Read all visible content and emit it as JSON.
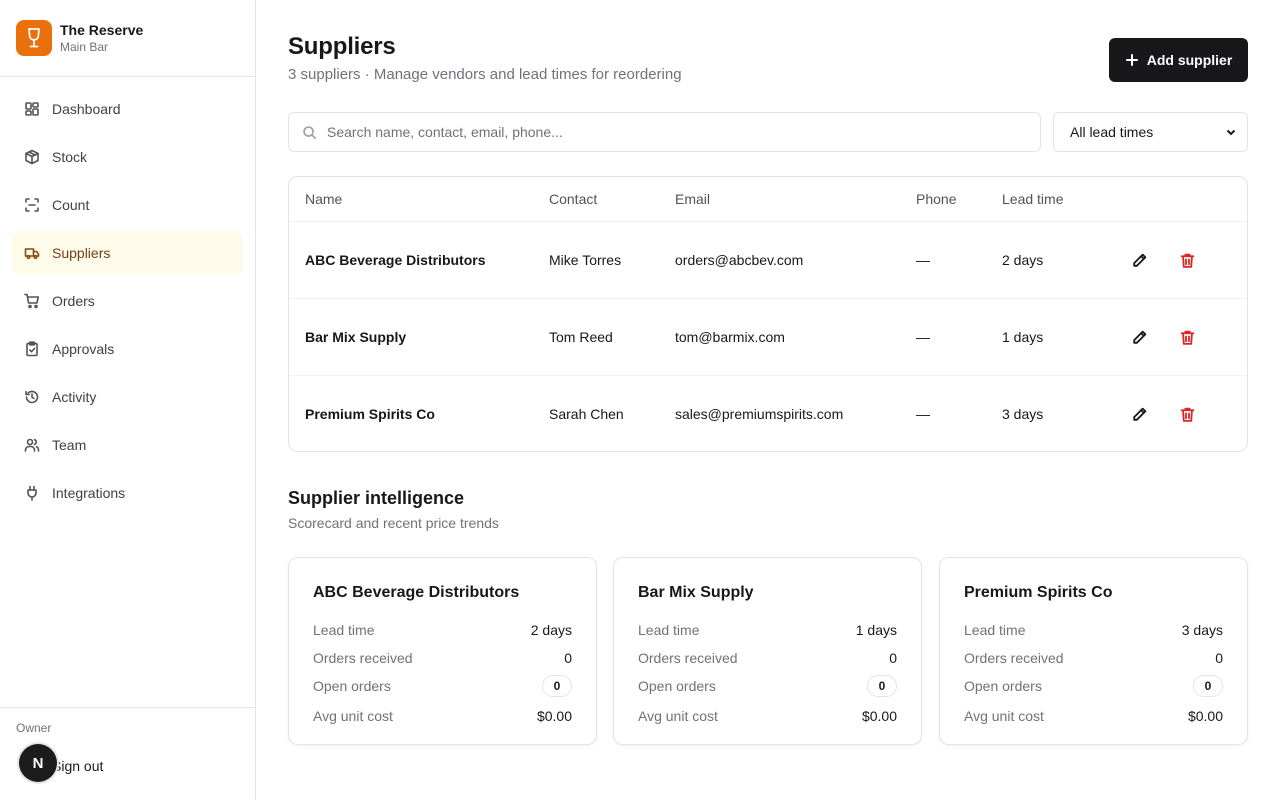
{
  "brand": {
    "name": "The Reserve",
    "subtitle": "Main Bar"
  },
  "nav": [
    {
      "label": "Dashboard",
      "icon": "dashboard-icon",
      "active": false
    },
    {
      "label": "Stock",
      "icon": "box-icon",
      "active": false
    },
    {
      "label": "Count",
      "icon": "scan-icon",
      "active": false
    },
    {
      "label": "Suppliers",
      "icon": "truck-icon",
      "active": true
    },
    {
      "label": "Orders",
      "icon": "cart-icon",
      "active": false
    },
    {
      "label": "Approvals",
      "icon": "clipboard-check-icon",
      "active": false
    },
    {
      "label": "Activity",
      "icon": "history-icon",
      "active": false
    },
    {
      "label": "Team",
      "icon": "users-icon",
      "active": false
    },
    {
      "label": "Integrations",
      "icon": "plug-icon",
      "active": false
    }
  ],
  "footer": {
    "role": "Owner",
    "sign_out": "Sign out",
    "avatar_initial": "N"
  },
  "header": {
    "title": "Suppliers",
    "subtitle": "3 suppliers · Manage vendors and lead times for reordering",
    "add_button": "Add supplier"
  },
  "filters": {
    "search_placeholder": "Search name, contact, email, phone...",
    "lead_time_select": "All lead times"
  },
  "table": {
    "columns": [
      "Name",
      "Contact",
      "Email",
      "Phone",
      "Lead time"
    ],
    "rows": [
      {
        "name": "ABC Beverage Distributors",
        "contact": "Mike Torres",
        "email": "orders@abcbev.com",
        "phone": "—",
        "lead_time": "2 days"
      },
      {
        "name": "Bar Mix Supply",
        "contact": "Tom Reed",
        "email": "tom@barmix.com",
        "phone": "—",
        "lead_time": "1 days"
      },
      {
        "name": "Premium Spirits Co",
        "contact": "Sarah Chen",
        "email": "sales@premiumspirits.com",
        "phone": "—",
        "lead_time": "3 days"
      }
    ]
  },
  "intelligence": {
    "title": "Supplier intelligence",
    "subtitle": "Scorecard and recent price trends",
    "labels": {
      "lead_time": "Lead time",
      "orders_received": "Orders received",
      "open_orders": "Open orders",
      "avg_unit_cost": "Avg unit cost"
    },
    "cards": [
      {
        "name": "ABC Beverage Distributors",
        "lead_time": "2 days",
        "orders_received": "0",
        "open_orders": "0",
        "avg_unit_cost": "$0.00"
      },
      {
        "name": "Bar Mix Supply",
        "lead_time": "1 days",
        "orders_received": "0",
        "open_orders": "0",
        "avg_unit_cost": "$0.00"
      },
      {
        "name": "Premium Spirits Co",
        "lead_time": "3 days",
        "orders_received": "0",
        "open_orders": "0",
        "avg_unit_cost": "$0.00"
      }
    ]
  },
  "colors": {
    "brand": "#ea700c",
    "active_nav_bg": "#fefbeb",
    "danger": "#dc2626",
    "primary_button": "#18181b"
  }
}
